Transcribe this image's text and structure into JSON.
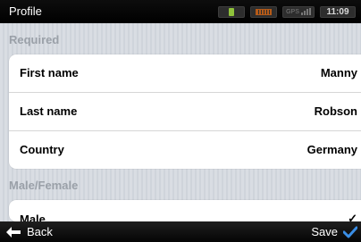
{
  "statusbar": {
    "title": "Profile",
    "clock": "11:09",
    "signal_label": "GPS",
    "icons": [
      "usb-icon",
      "battery-icon",
      "signal-icon"
    ],
    "colors": {
      "usb": "#8fc23b",
      "battery": "#b45a18"
    }
  },
  "sections": {
    "required": "Required",
    "gender": "Male/Female"
  },
  "required_fields": [
    {
      "label": "First name",
      "value": "Manny"
    },
    {
      "label": "Last name",
      "value": "Robson"
    },
    {
      "label": "Country",
      "value": "Germany"
    }
  ],
  "gender_field": {
    "label": "Male",
    "value": "✓"
  },
  "toolbar": {
    "back_label": "Back",
    "save_label": "Save",
    "save_icon_color": "#3a8ee6"
  }
}
